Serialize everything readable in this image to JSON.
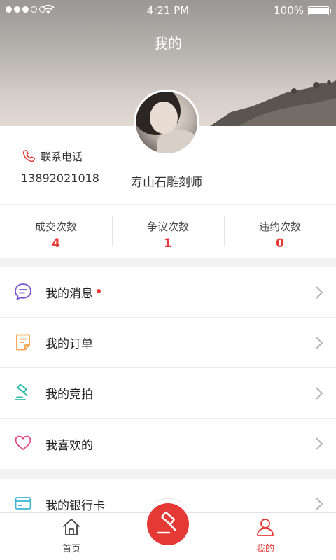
{
  "status_bar": {
    "time": "4:21 PM",
    "battery": "100%"
  },
  "header": {
    "title": "我的"
  },
  "profile": {
    "contact_label": "联系电话",
    "phone": "13892021018",
    "nickname": "寿山石雕刻师"
  },
  "stats": [
    {
      "label": "成交次数",
      "value": "4"
    },
    {
      "label": "争议次数",
      "value": "1"
    },
    {
      "label": "违约次数",
      "value": "0"
    }
  ],
  "menu": {
    "group1": [
      {
        "label": "我的消息",
        "icon": "message-icon",
        "badge_dot": true
      },
      {
        "label": "我的订单",
        "icon": "order-icon"
      },
      {
        "label": "我的竞拍",
        "icon": "auction-icon"
      },
      {
        "label": "我喜欢的",
        "icon": "heart-icon"
      }
    ],
    "group2": [
      {
        "label": "我的银行卡",
        "icon": "bank-card-icon"
      }
    ]
  },
  "tabbar": {
    "home_label": "首页",
    "me_label": "我的"
  },
  "colors": {
    "accent": "#e53935",
    "message_icon": "#7b4fd6",
    "order_icon": "#f0a24a",
    "auction_icon": "#27b9a5",
    "heart_icon": "#e0457b",
    "bank_icon": "#39b6d8"
  }
}
